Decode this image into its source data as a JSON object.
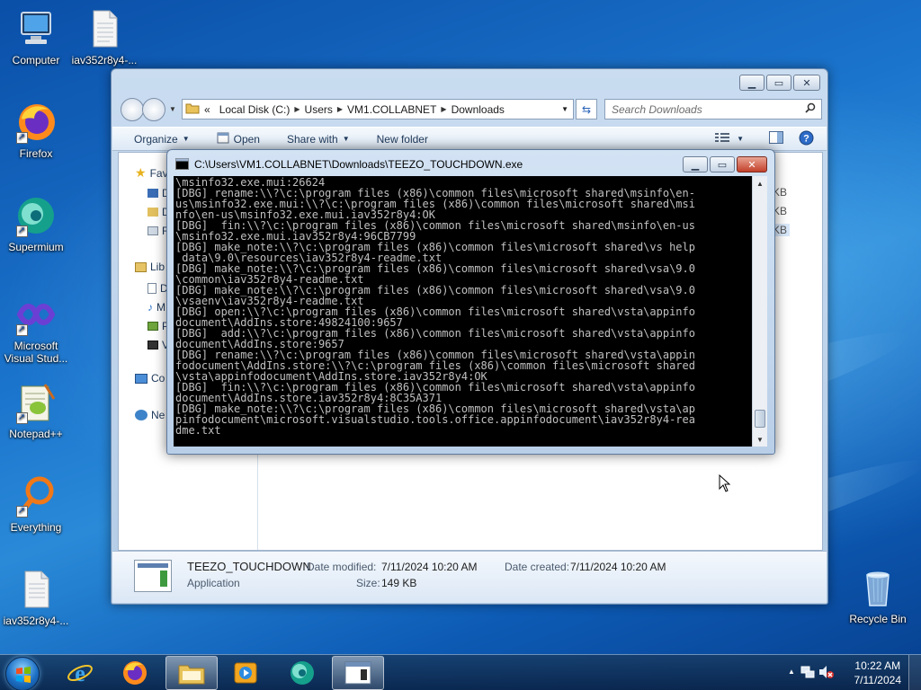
{
  "desktop": {
    "icons": [
      {
        "label": "Computer",
        "icon": "computer-icon"
      },
      {
        "label": "iav352r8y4-...",
        "icon": "text-file-icon"
      },
      {
        "label": "Firefox",
        "icon": "firefox-icon"
      },
      {
        "label": "Supermium",
        "icon": "supermium-icon"
      },
      {
        "label": "Microsoft Visual Stud...",
        "icon": "visual-studio-icon"
      },
      {
        "label": "Notepad++",
        "icon": "notepadpp-icon"
      },
      {
        "label": "Everything",
        "icon": "everything-icon"
      },
      {
        "label": "iav352r8y4-...",
        "icon": "text-file-icon"
      },
      {
        "label": "Recycle Bin",
        "icon": "recycle-bin-icon"
      }
    ]
  },
  "explorer": {
    "address": {
      "crumbs": [
        "Local Disk (C:)",
        "Users",
        "VM1.COLLABNET",
        "Downloads"
      ],
      "overflow": "«"
    },
    "search_placeholder": "Search Downloads",
    "toolbar": {
      "organize": "Organize",
      "open": "Open",
      "share_with": "Share with",
      "new_folder": "New folder"
    },
    "navpane": {
      "favorites": "Fav",
      "libraries": "Lib",
      "computer": "Co",
      "network": "Ne",
      "fav_items": [
        "D",
        "D",
        "R"
      ],
      "lib_items": [
        "D",
        "M",
        "P",
        "V"
      ]
    },
    "sizes": [
      "KB",
      "KB",
      "KB"
    ],
    "details": {
      "name": "TEEZO_TOUCHDOWN",
      "type": "Application",
      "date_modified_label": "Date modified:",
      "date_modified": "7/11/2024 10:20 AM",
      "date_created_label": "Date created:",
      "date_created": "7/11/2024 10:20 AM",
      "size_label": "Size:",
      "size": "149 KB"
    }
  },
  "console": {
    "title": "C:\\Users\\VM1.COLLABNET\\Downloads\\TEEZO_TOUCHDOWN.exe",
    "lines": [
      "\\msinfo32.exe.mui:26624",
      "[DBG] rename:\\\\?\\c:\\program files (x86)\\common files\\microsoft shared\\msinfo\\en-",
      "us\\msinfo32.exe.mui:\\\\?\\c:\\program files (x86)\\common files\\microsoft shared\\msi",
      "nfo\\en-us\\msinfo32.exe.mui.iav352r8y4:OK",
      "[DBG]  fin:\\\\?\\c:\\program files (x86)\\common files\\microsoft shared\\msinfo\\en-us",
      "\\msinfo32.exe.mui.iav352r8y4:96CB7799",
      "[DBG] make_note:\\\\?\\c:\\program files (x86)\\common files\\microsoft shared\\vs help",
      " data\\9.0\\resources\\iav352r8y4-readme.txt",
      "[DBG] make_note:\\\\?\\c:\\program files (x86)\\common files\\microsoft shared\\vsa\\9.0",
      "\\common\\iav352r8y4-readme.txt",
      "[DBG] make_note:\\\\?\\c:\\program files (x86)\\common files\\microsoft shared\\vsa\\9.0",
      "\\vsaenv\\iav352r8y4-readme.txt",
      "[DBG] open:\\\\?\\c:\\program files (x86)\\common files\\microsoft shared\\vsta\\appinfo",
      "document\\AddIns.store:49824100:9657",
      "[DBG]  add:\\\\?\\c:\\program files (x86)\\common files\\microsoft shared\\vsta\\appinfo",
      "document\\AddIns.store:9657",
      "[DBG] rename:\\\\?\\c:\\program files (x86)\\common files\\microsoft shared\\vsta\\appin",
      "fodocument\\AddIns.store:\\\\?\\c:\\program files (x86)\\common files\\microsoft shared",
      "\\vsta\\appinfodocument\\AddIns.store.iav352r8y4:OK",
      "[DBG]  fin:\\\\?\\c:\\program files (x86)\\common files\\microsoft shared\\vsta\\appinfo",
      "document\\AddIns.store.iav352r8y4:8C35A371",
      "[DBG] make_note:\\\\?\\c:\\program files (x86)\\common files\\microsoft shared\\vsta\\ap",
      "pinfodocument\\microsoft.visualstudio.tools.office.appinfodocument\\iav352r8y4-rea",
      "dme.txt",
      "_"
    ]
  },
  "taskbar": {
    "apps": [
      "internet-explorer-icon",
      "firefox-icon",
      "file-explorer-icon",
      "media-player-icon",
      "supermium-icon",
      "console-app-icon"
    ],
    "clock_time": "10:22 AM",
    "clock_date": "7/11/2024"
  }
}
